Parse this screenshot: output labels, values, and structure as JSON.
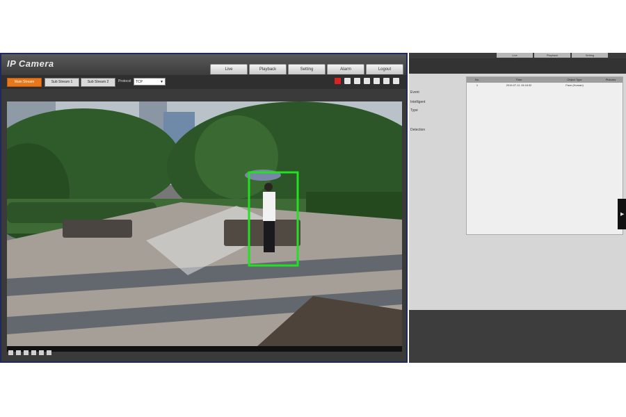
{
  "camera_window": {
    "logo": "IP Camera",
    "nav_tabs": [
      "Live",
      "Playback",
      "Setting",
      "Alarm",
      "Logout"
    ],
    "toolbar": {
      "streams": [
        "Main Stream",
        "Sub Stream 1",
        "Sub Stream 2"
      ],
      "protocol_label": "Protocol",
      "protocol_value": "TCP",
      "icons": [
        "alarm-icon",
        "snapshot-icon",
        "fullscreen-icon",
        "record-icon",
        "video-icon",
        "audio-icon",
        "mic-icon"
      ]
    },
    "detection_box_color": "#23e023",
    "bottom_controls": [
      "stop-icon",
      "window-icon",
      "zoom-icon",
      "ratio-icon",
      "fluency-icon",
      "rules-icon"
    ]
  },
  "right_panel": {
    "tabs": [
      "Live",
      "Playback",
      "Setting"
    ],
    "side_labels": [
      "Event",
      "Intelligent",
      "Type",
      "Detection"
    ],
    "table": {
      "columns": [
        "No.",
        "Time",
        "Object Type",
        "Pictures"
      ],
      "rows": [
        {
          "no": "1",
          "time": "2019-07-11 15:18:32",
          "type": "Face (Human)",
          "extra": ""
        }
      ]
    }
  }
}
